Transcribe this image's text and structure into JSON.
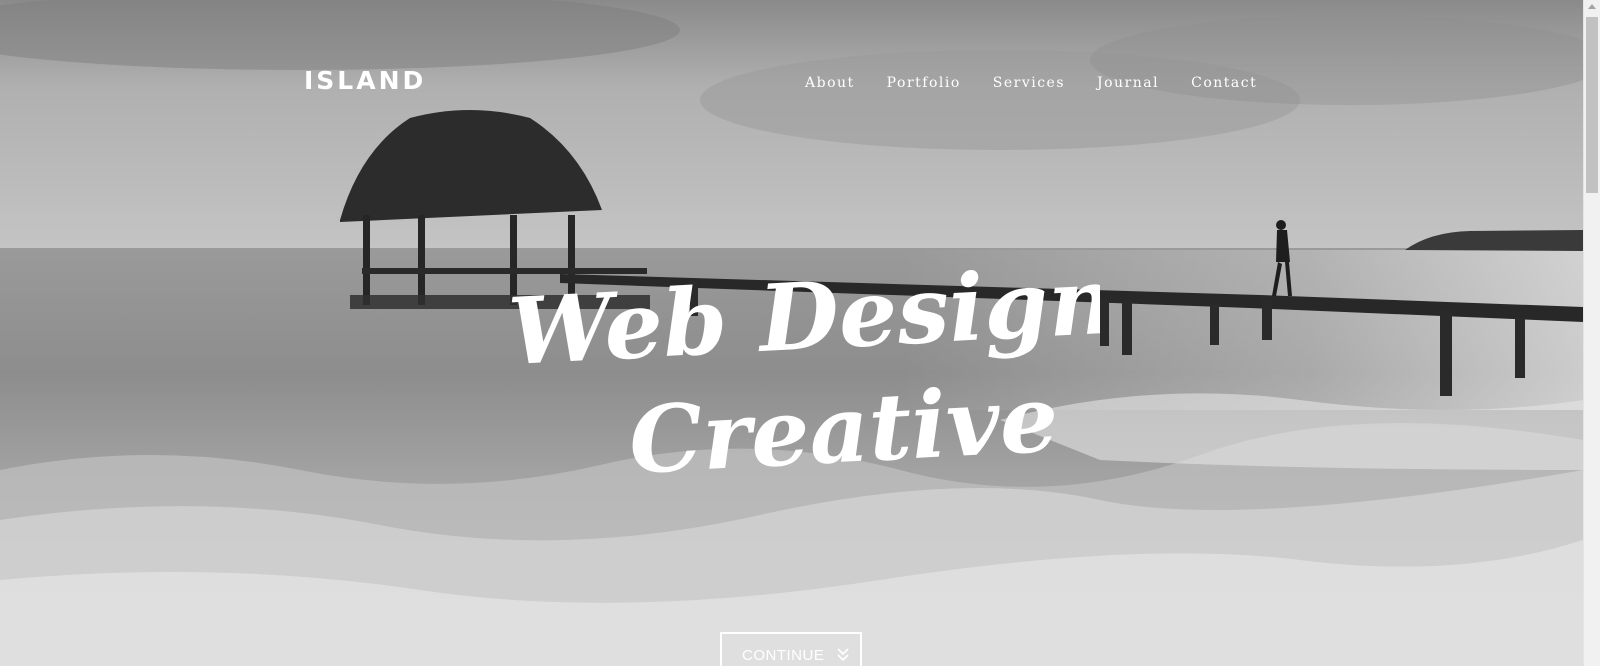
{
  "header": {
    "logo": "ISLAND",
    "nav": [
      {
        "label": "About"
      },
      {
        "label": "Portfolio"
      },
      {
        "label": "Services"
      },
      {
        "label": "Journal"
      },
      {
        "label": "Contact"
      }
    ]
  },
  "hero": {
    "headline_line1": "Web Design +",
    "headline_line2": "Creative",
    "image": "black-and-white beach with thatched hut, wooden pier and waves",
    "cta_label": "CONTINUE",
    "cta_icon": "double-chevron-down-icon"
  },
  "colors": {
    "text": "#ffffff",
    "sky": "#a9a9a9",
    "sea": "#8c8c8c",
    "foam": "#e8e8e8"
  }
}
